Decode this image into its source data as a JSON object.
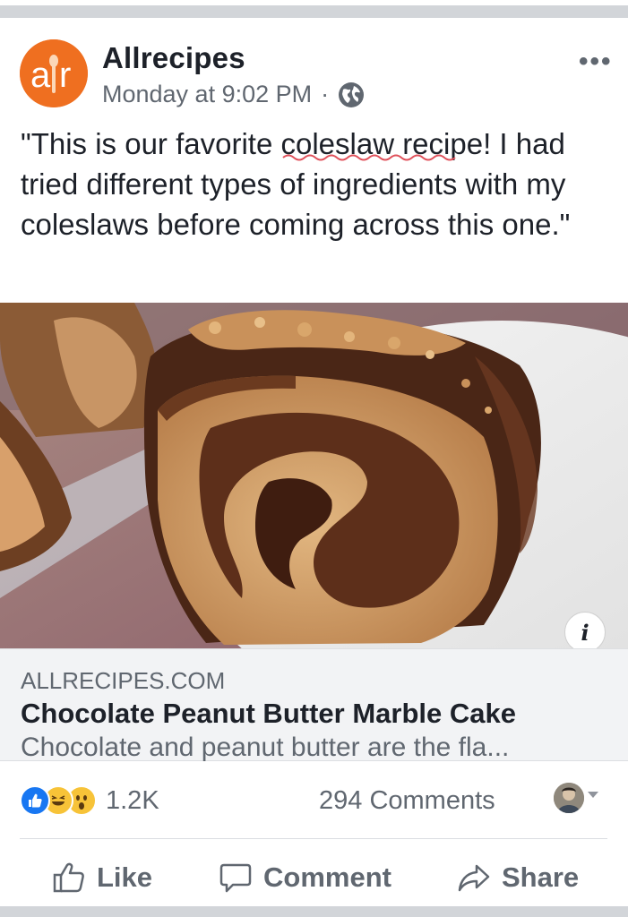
{
  "post": {
    "page_name": "Allrecipes",
    "timestamp": "Monday at 9:02 PM",
    "separator": "·",
    "audience_icon": "globe-icon",
    "more_icon": "•••",
    "text": "\"This is our favorite coleslaw recipe! I had tried different types of ingredients with my coleslaws before coming across this one.\"",
    "avatar_letters": "ar"
  },
  "link": {
    "domain": "ALLRECIPES.COM",
    "title": "Chocolate Peanut Butter Marble Cake",
    "description": "Chocolate and peanut butter are the fla...",
    "info_icon": "i"
  },
  "engagement": {
    "reaction_icons": [
      "like-reaction-icon",
      "haha-reaction-icon",
      "wow-reaction-icon"
    ],
    "reaction_count": "1.2K",
    "comments_count": "294 Comments"
  },
  "actions": {
    "like": "Like",
    "comment": "Comment",
    "share": "Share"
  },
  "colors": {
    "brand_orange": "#ef6f20",
    "like_blue": "#1877f2",
    "reaction_yellow": "#f7c338",
    "text_primary": "#1d2129",
    "text_secondary": "#606770"
  }
}
